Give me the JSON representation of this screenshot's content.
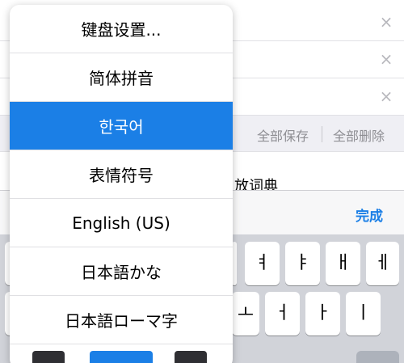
{
  "background": {
    "rows": [
      {
        "close_icon": "×"
      },
      {
        "close_icon": "×"
      },
      {
        "close_icon": "×"
      }
    ],
    "toolbar": {
      "save_all": "全部保存",
      "delete_all": "全部删除"
    },
    "dictionary_text": "放词典"
  },
  "accessory": {
    "done_label": "完成"
  },
  "keyboard": {
    "row1_keys": [
      "ㅕ",
      "ㅑ",
      "ㅐ",
      "ㅔ"
    ],
    "row2_keys": [
      "ㅗ",
      "ㅓ",
      "ㅏ",
      "ㅣ"
    ]
  },
  "menu": {
    "items": [
      {
        "label": "键盘设置..."
      },
      {
        "label": "简体拼音"
      },
      {
        "label": "한국어",
        "selected": true
      },
      {
        "label": "表情符号"
      },
      {
        "label": "English (US)"
      },
      {
        "label": "日本語かな"
      },
      {
        "label": "日本語ローマ字"
      }
    ]
  },
  "colors": {
    "accent": "#1b7fe6",
    "keyboard_bg": "#d1d3d9"
  }
}
